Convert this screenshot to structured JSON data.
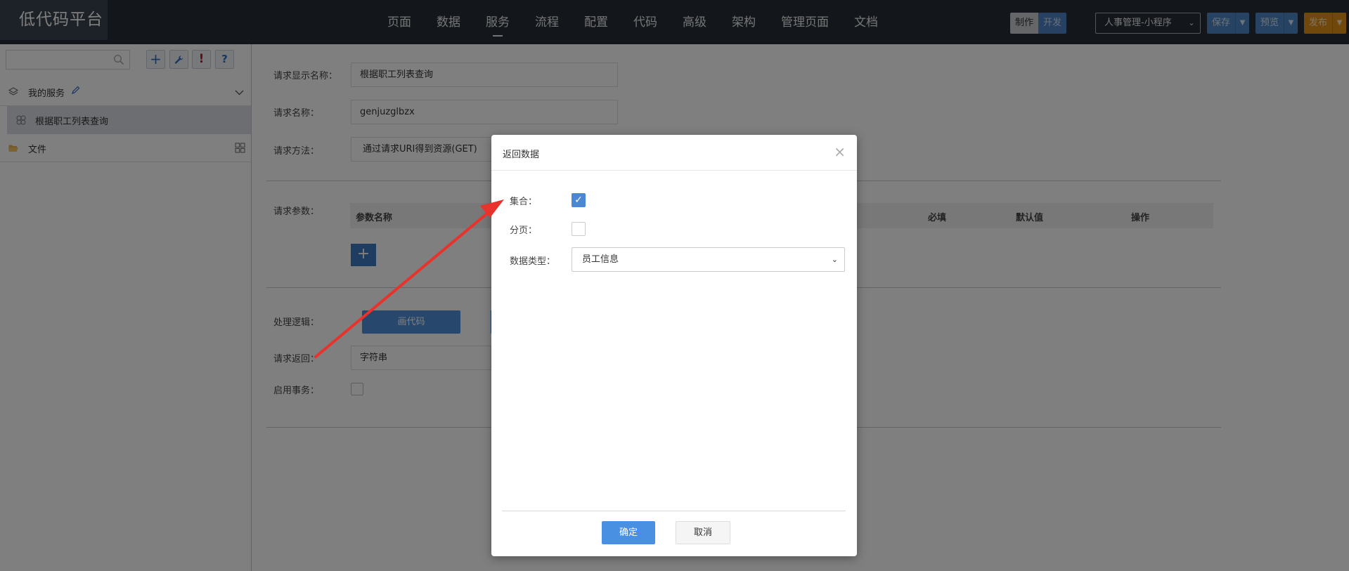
{
  "app": {
    "logo": "低代码平台"
  },
  "nav": {
    "items": [
      {
        "label": "页面"
      },
      {
        "label": "数据"
      },
      {
        "label": "服务"
      },
      {
        "label": "流程"
      },
      {
        "label": "配置"
      },
      {
        "label": "代码"
      },
      {
        "label": "高级"
      },
      {
        "label": "架构"
      },
      {
        "label": "管理页面"
      },
      {
        "label": "文档"
      }
    ],
    "active": "服务"
  },
  "toolbar": {
    "mode_make": "制作",
    "mode_dev": "开发",
    "app_select": "人事管理-小程序",
    "save": "保存",
    "preview": "预览",
    "publish": "发布"
  },
  "sidebar": {
    "search_placeholder": "",
    "my_services": "我的服务",
    "service_item": "根据职工列表查询",
    "files": "文件"
  },
  "form": {
    "display_name_label": "请求显示名称：",
    "display_name_value": "根据职工列表查询",
    "name_label": "请求名称：",
    "name_value": "genjuzglbzx",
    "method_label": "请求方法：",
    "method_value": "通过请求URI得到资源(GET)",
    "params_label": "请求参数：",
    "params_columns": [
      "参数名称",
      "必填",
      "默认值",
      "操作"
    ],
    "logic_label": "处理逻辑：",
    "draw_code": "画代码",
    "return_label": "请求返回：",
    "return_value": "字符串",
    "tx_label": "启用事务："
  },
  "modal": {
    "title": "返回数据",
    "collection_label": "集合：",
    "collection_checked": true,
    "paging_label": "分页：",
    "paging_checked": false,
    "data_type_label": "数据类型：",
    "data_type_value": "员工信息",
    "ok": "确定",
    "cancel": "取消"
  },
  "colors": {
    "topbar": "#262d36",
    "primary": "#4a90e2",
    "publish": "#e29119",
    "annotation_arrow": "#e8322b"
  }
}
